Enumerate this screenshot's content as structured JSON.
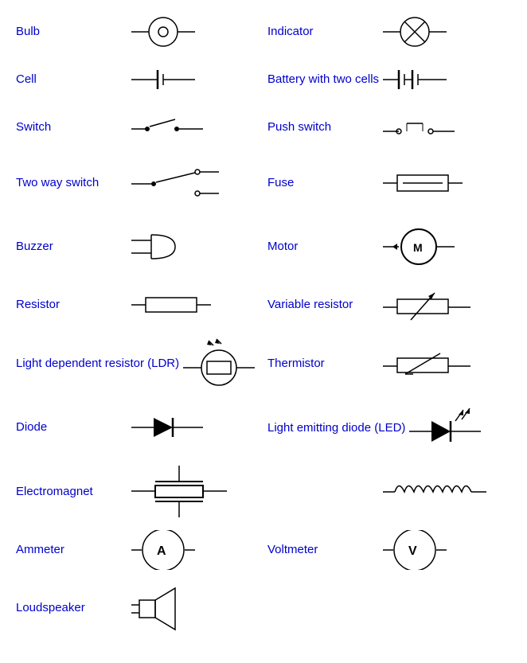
{
  "items": [
    {
      "id": "bulb",
      "label": "Bulb"
    },
    {
      "id": "indicator",
      "label": "Indicator"
    },
    {
      "id": "cell",
      "label": "Cell"
    },
    {
      "id": "battery-two-cells",
      "label": "Battery with two cells"
    },
    {
      "id": "switch",
      "label": "Switch"
    },
    {
      "id": "push-switch",
      "label": "Push switch"
    },
    {
      "id": "two-way-switch",
      "label": "Two way switch"
    },
    {
      "id": "fuse",
      "label": "Fuse"
    },
    {
      "id": "buzzer",
      "label": "Buzzer"
    },
    {
      "id": "motor",
      "label": "Motor"
    },
    {
      "id": "resistor",
      "label": "Resistor"
    },
    {
      "id": "variable-resistor",
      "label": "Variable resistor"
    },
    {
      "id": "ldr",
      "label": "Light dependent resistor  (LDR)"
    },
    {
      "id": "thermistor",
      "label": "Thermistor"
    },
    {
      "id": "diode",
      "label": "Diode"
    },
    {
      "id": "led",
      "label": "Light emitting diode (LED)"
    },
    {
      "id": "electromagnet",
      "label": "Electromagnet"
    },
    {
      "id": "inductor",
      "label": ""
    },
    {
      "id": "ammeter",
      "label": "Ammeter"
    },
    {
      "id": "voltmeter",
      "label": "Voltmeter"
    },
    {
      "id": "loudspeaker",
      "label": "Loudspeaker"
    },
    {
      "id": "empty",
      "label": ""
    }
  ]
}
